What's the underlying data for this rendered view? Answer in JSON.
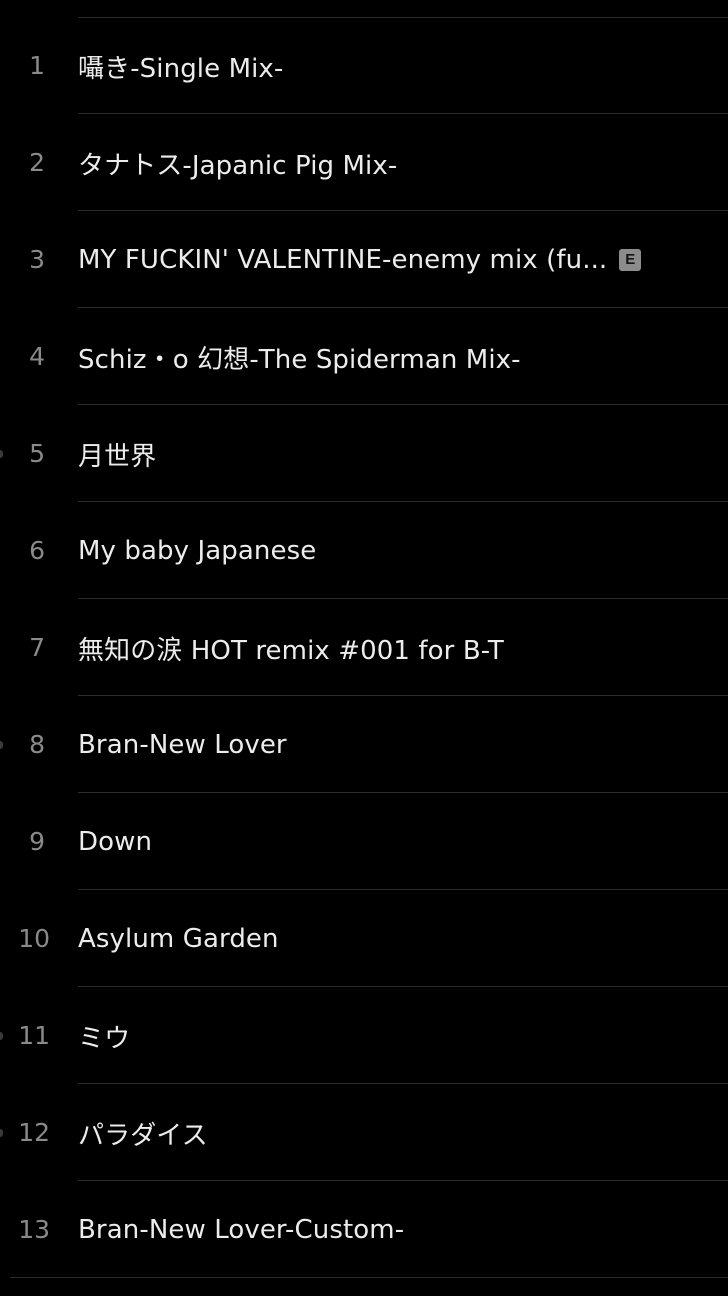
{
  "colors": {
    "background": "#000000",
    "title_text": "#ececec",
    "number_text": "#8a8a8a",
    "separator": "#2b2b2b",
    "explicit_badge": "#8c8c8c"
  },
  "tracks": [
    {
      "number": "1",
      "title": "囁き-Single Mix-"
    },
    {
      "number": "2",
      "title": "タナトス-Japanic Pig Mix-"
    },
    {
      "number": "3",
      "title": "MY FUCKIN' VALENTINE-enemy mix (fu...",
      "badge": "E"
    },
    {
      "number": "4",
      "title": "Schiz・o 幻想-The Spiderman Mix-"
    },
    {
      "number": "5",
      "title": "月世界"
    },
    {
      "number": "6",
      "title": "My baby Japanese"
    },
    {
      "number": "7",
      "title": "無知の涙 HOT remix #001 for B-T"
    },
    {
      "number": "8",
      "title": "Bran-New Lover"
    },
    {
      "number": "9",
      "title": "Down"
    },
    {
      "number": "10",
      "title": "Asylum Garden"
    },
    {
      "number": "11",
      "title": "ミウ"
    },
    {
      "number": "12",
      "title": "パラダイス"
    },
    {
      "number": "13",
      "title": "Bran-New Lover-Custom-"
    }
  ]
}
